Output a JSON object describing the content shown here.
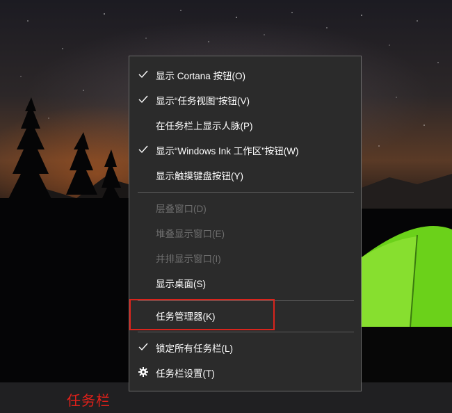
{
  "context_menu": {
    "items": [
      {
        "label": "显示 Cortana 按钮(O)",
        "checked": true,
        "enabled": true
      },
      {
        "label": "显示“任务视图”按钮(V)",
        "checked": true,
        "enabled": true
      },
      {
        "label": "在任务栏上显示人脉(P)",
        "checked": false,
        "enabled": true
      },
      {
        "label": "显示“Windows Ink 工作区”按钮(W)",
        "checked": true,
        "enabled": true
      },
      {
        "label": "显示触摸键盘按钮(Y)",
        "checked": false,
        "enabled": true
      },
      {
        "label": "层叠窗口(D)",
        "checked": false,
        "enabled": false
      },
      {
        "label": "堆叠显示窗口(E)",
        "checked": false,
        "enabled": false
      },
      {
        "label": "并排显示窗口(I)",
        "checked": false,
        "enabled": false
      },
      {
        "label": "显示桌面(S)",
        "checked": false,
        "enabled": true
      },
      {
        "label": "任务管理器(K)",
        "checked": false,
        "enabled": true,
        "highlighted": true
      },
      {
        "label": "锁定所有任务栏(L)",
        "checked": true,
        "enabled": true
      },
      {
        "label": "任务栏设置(T)",
        "checked": false,
        "enabled": true,
        "icon": "gear-icon"
      }
    ]
  },
  "annotation": {
    "label": "任务栏",
    "color": "#e0201a"
  },
  "colors": {
    "menu_bg": "#2b2b2b",
    "highlight_border": "#d9241c",
    "disabled_text": "#6e6e6e"
  }
}
